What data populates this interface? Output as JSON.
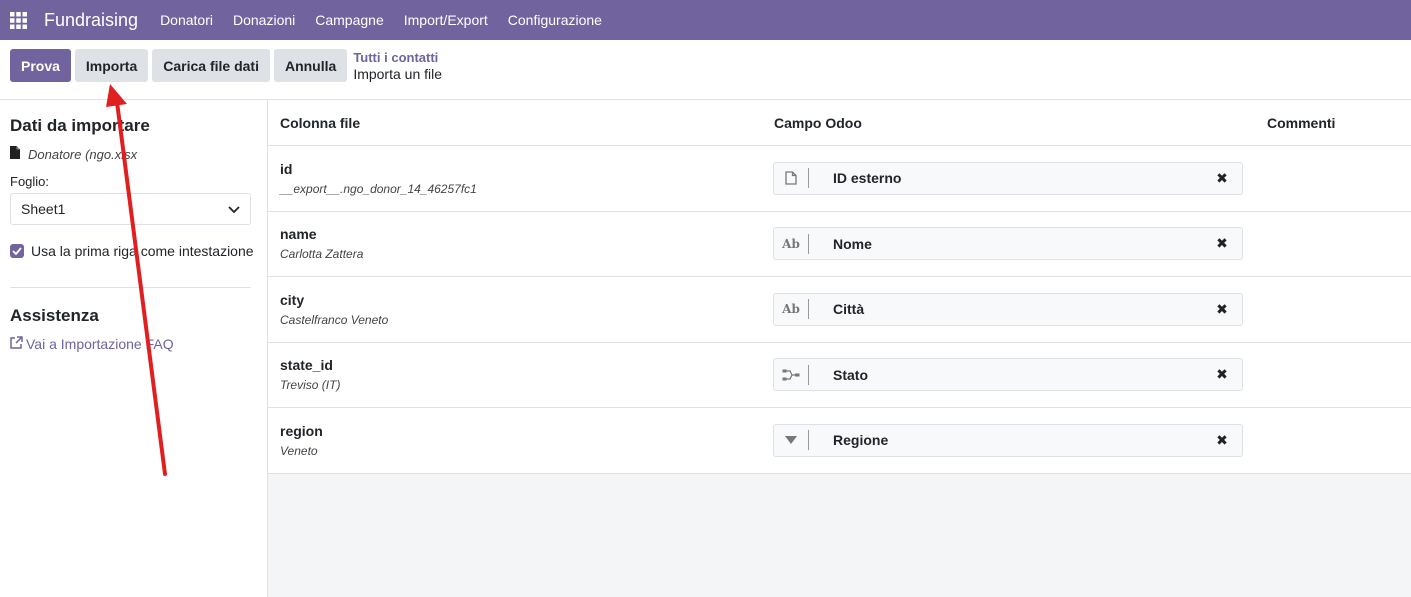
{
  "navbar": {
    "brand": "Fundraising",
    "menu": [
      "Donatori",
      "Donazioni",
      "Campagne",
      "Import/Export",
      "Configurazione"
    ]
  },
  "toolbar": {
    "test_label": "Prova",
    "import_label": "Importa",
    "load_label": "Carica file dati",
    "cancel_label": "Annulla"
  },
  "breadcrumb": {
    "parent": "Tutti i contatti",
    "current": "Importa un file"
  },
  "sidebar": {
    "title": "Dati da importare",
    "file_name": "Donatore (ngo.xlsx",
    "sheet_label": "Foglio:",
    "sheet_value": "Sheet1",
    "header_checkbox_label": "Usa la prima riga come intestazione",
    "header_checked": true,
    "help_title": "Assistenza",
    "help_link": "Vai a Importazione FAQ"
  },
  "table": {
    "headers": {
      "file_column": "Colonna file",
      "odoo_field": "Campo Odoo",
      "comments": "Commenti"
    },
    "rows": [
      {
        "name": "id",
        "sample": "__export__.ngo_donor_14_46257fc1",
        "icon": "file-icon",
        "field": "ID esterno"
      },
      {
        "name": "name",
        "sample": "Carlotta Zattera",
        "icon": "text-ab-icon",
        "field": "Nome"
      },
      {
        "name": "city",
        "sample": "Castelfranco Veneto",
        "icon": "text-ab-icon",
        "field": "Città"
      },
      {
        "name": "state_id",
        "sample": "Treviso (IT)",
        "icon": "relation-icon",
        "field": "Stato"
      },
      {
        "name": "region",
        "sample": "Veneto",
        "icon": "selection-caret-icon",
        "field": "Regione"
      }
    ]
  },
  "colors": {
    "brand": "#71639e",
    "annotation_arrow": "#e02020"
  }
}
